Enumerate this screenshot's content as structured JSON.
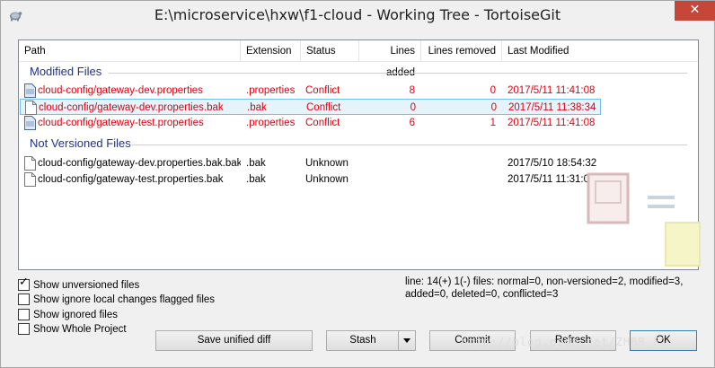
{
  "window": {
    "title": "E:\\microservice\\hxw\\f1-cloud - Working Tree - TortoiseGit",
    "close_glyph": "✕"
  },
  "columns": [
    "Path",
    "Extension",
    "Status",
    "Lines added",
    "Lines removed",
    "Last Modified"
  ],
  "groups": {
    "modified": "Modified Files",
    "unversioned": "Not Versioned Files"
  },
  "modified_files": [
    {
      "path": "cloud-config/gateway-dev.properties",
      "ext": ".properties",
      "status": "Conflict",
      "added": "8",
      "removed": "0",
      "modified": "2017/5/11 11:41:08",
      "icon": "modified-file-icon"
    },
    {
      "path": "cloud-config/gateway-dev.properties.bak",
      "ext": ".bak",
      "status": "Conflict",
      "added": "0",
      "removed": "0",
      "modified": "2017/5/11 11:38:34",
      "icon": "file-icon"
    },
    {
      "path": "cloud-config/gateway-test.properties",
      "ext": ".properties",
      "status": "Conflict",
      "added": "6",
      "removed": "1",
      "modified": "2017/5/11 11:41:08",
      "icon": "modified-file-icon"
    }
  ],
  "unversioned_files": [
    {
      "path": "cloud-config/gateway-dev.properties.bak.bak",
      "ext": ".bak",
      "status": "Unknown",
      "added": "",
      "removed": "",
      "modified": "2017/5/10 18:54:32",
      "icon": "file-icon"
    },
    {
      "path": "cloud-config/gateway-test.properties.bak",
      "ext": ".bak",
      "status": "Unknown",
      "added": "",
      "removed": "",
      "modified": "2017/5/11 11:31:01",
      "icon": "file-icon"
    }
  ],
  "options": [
    {
      "label": "Show unversioned files",
      "checked": true
    },
    {
      "label": "Show ignore local changes flagged files",
      "checked": false
    },
    {
      "label": "Show ignored files",
      "checked": false
    },
    {
      "label": "Show Whole Project",
      "checked": false
    }
  ],
  "status_text": "line: 14(+) 1(-) files: normal=0, non-versioned=2, modified=3, added=0, deleted=0, conflicted=3",
  "buttons": {
    "save_diff": "Save unified diff",
    "stash": "Stash",
    "commit": "Commit",
    "refresh": "Refresh",
    "ok": "OK"
  },
  "watermark_text": "http://blog.csdn.net/ZHBR_F1",
  "colors": {
    "conflict": "#e0000e",
    "group_header": "#1e3287",
    "selection": "#e5f3fb",
    "close_button": "#c7463a"
  }
}
